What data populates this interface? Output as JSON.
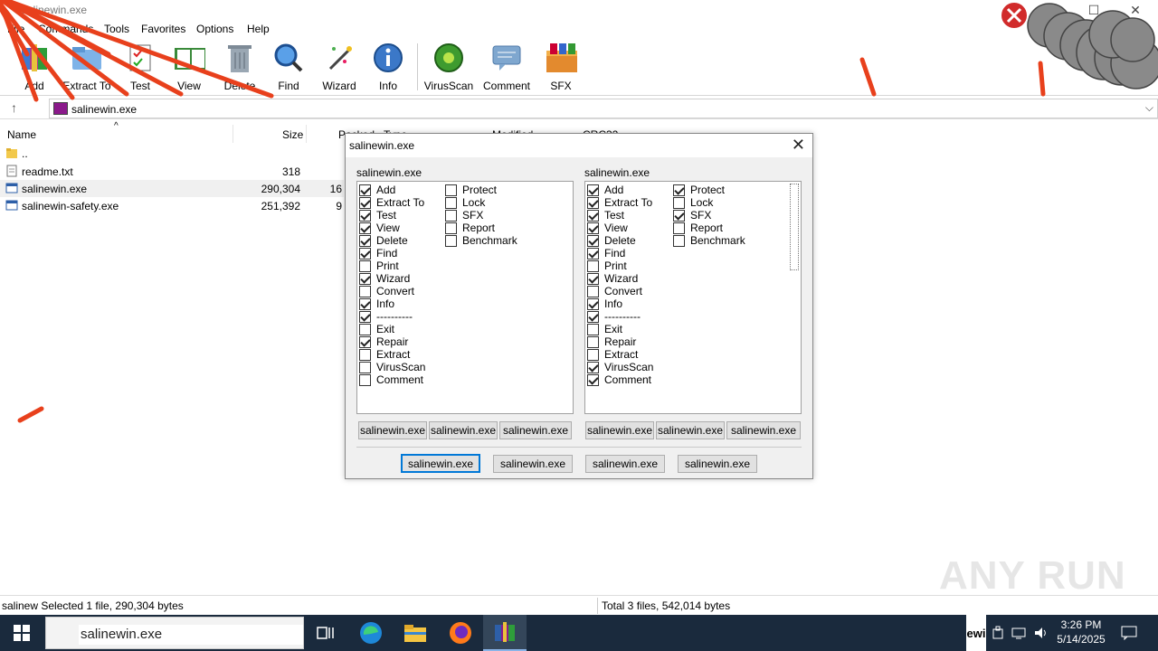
{
  "window": {
    "title": "salinewin.exe",
    "minimize": "—",
    "maximize": "☐",
    "close": "✕"
  },
  "menu": [
    "File",
    "Commands",
    "Tools",
    "Favorites",
    "Options",
    "Help"
  ],
  "toolbar": {
    "add": "Add",
    "extract_to": "Extract To",
    "test": "Test",
    "view": "View",
    "delete": "Delete",
    "find": "Find",
    "wizard": "Wizard",
    "info": "Info",
    "virusscan": "VirusScan",
    "comment": "Comment",
    "sfx": "SFX"
  },
  "address": {
    "path": "salinewin.exe",
    "up_icon": "arrow-up-icon"
  },
  "columns": {
    "name": "Name",
    "size": "Size",
    "packed": "Packed",
    "type": "Type",
    "modified": "Modified",
    "crc": "CRC32"
  },
  "files": [
    {
      "name": "..",
      "size": ""
    },
    {
      "name": "readme.txt",
      "size": "318"
    },
    {
      "name": "salinewin.exe",
      "size": "290,304",
      "packed": "16"
    },
    {
      "name": "salinewin-safety.exe",
      "size": "251,392",
      "packed": "9"
    }
  ],
  "status": {
    "left": "salinew  Selected 1 file, 290,304 bytes",
    "right": "Total 3 files, 542,014 bytes"
  },
  "dialog": {
    "title": "salinewin.exe",
    "close": "✕",
    "left_group_label": "salinewin.exe",
    "right_group_label": "salinewin.exe",
    "left_col1": [
      {
        "label": "Add",
        "checked": true
      },
      {
        "label": "Extract To",
        "checked": true
      },
      {
        "label": "Test",
        "checked": true
      },
      {
        "label": "View",
        "checked": true
      },
      {
        "label": "Delete",
        "checked": true
      },
      {
        "label": "Find",
        "checked": true
      },
      {
        "label": "Print",
        "checked": false
      },
      {
        "label": "Wizard",
        "checked": true
      },
      {
        "label": "Convert",
        "checked": false
      },
      {
        "label": "Info",
        "checked": true
      },
      {
        "label": "----------",
        "checked": true
      },
      {
        "label": "Exit",
        "checked": false
      },
      {
        "label": "Repair",
        "checked": true
      },
      {
        "label": "Extract",
        "checked": false
      },
      {
        "label": "VirusScan",
        "checked": false
      },
      {
        "label": "Comment",
        "checked": false
      }
    ],
    "left_col2": [
      {
        "label": "Protect",
        "checked": false
      },
      {
        "label": "Lock",
        "checked": false
      },
      {
        "label": "SFX",
        "checked": false
      },
      {
        "label": "Report",
        "checked": false
      },
      {
        "label": "Benchmark",
        "checked": false
      }
    ],
    "right_col1": [
      {
        "label": "Add",
        "checked": true
      },
      {
        "label": "Extract To",
        "checked": true
      },
      {
        "label": "Test",
        "checked": true
      },
      {
        "label": "View",
        "checked": true
      },
      {
        "label": "Delete",
        "checked": true
      },
      {
        "label": "Find",
        "checked": true
      },
      {
        "label": "Print",
        "checked": false
      },
      {
        "label": "Wizard",
        "checked": true
      },
      {
        "label": "Convert",
        "checked": false
      },
      {
        "label": "Info",
        "checked": true
      },
      {
        "label": "----------",
        "checked": true
      },
      {
        "label": "Exit",
        "checked": false
      },
      {
        "label": "Repair",
        "checked": false
      },
      {
        "label": "Extract",
        "checked": false
      },
      {
        "label": "VirusScan",
        "checked": true
      },
      {
        "label": "Comment",
        "checked": true
      }
    ],
    "right_col2": [
      {
        "label": "Protect",
        "checked": true
      },
      {
        "label": "Lock",
        "checked": false
      },
      {
        "label": "SFX",
        "checked": true
      },
      {
        "label": "Report",
        "checked": false
      },
      {
        "label": "Benchmark",
        "checked": false
      }
    ],
    "left_buttons": [
      "salinewin.exe",
      "salinewin.exe",
      "salinewin.exe"
    ],
    "right_buttons": [
      "salinewin.exe",
      "salinewin.exe",
      "salinewin.exe"
    ],
    "bottom_buttons": [
      "salinewin.exe",
      "salinewin.exe",
      "salinewin.exe",
      "salinewin.exe"
    ]
  },
  "taskbar": {
    "search_text": "salinewin.exe",
    "tray_label": "ewi",
    "time": "3:26 PM",
    "date": "5/14/2025"
  },
  "watermark": "ANY RUN",
  "colors": {
    "taskbar": "#1a2a3d",
    "dialog_bg": "#f0f0f0",
    "default_button_border": "#0078d7",
    "malware_stroke": "#e8401c"
  }
}
